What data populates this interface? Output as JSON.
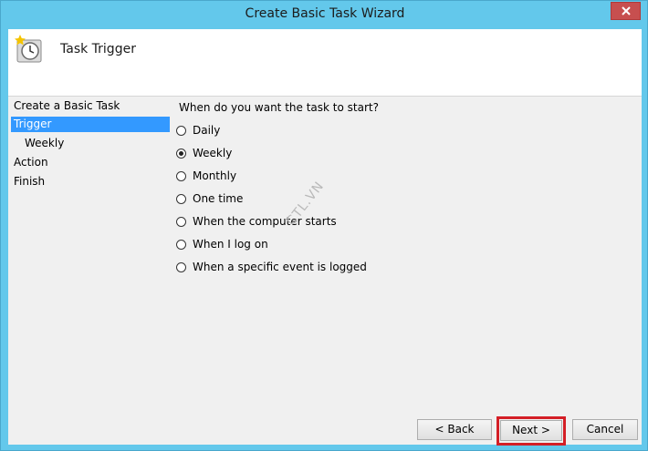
{
  "window": {
    "title": "Create Basic Task Wizard"
  },
  "header": {
    "title": "Task Trigger",
    "icon": "clock-star-icon"
  },
  "nav": {
    "items": [
      {
        "label": "Create a Basic Task"
      },
      {
        "label": "Trigger"
      },
      {
        "label": "Weekly"
      },
      {
        "label": "Action"
      },
      {
        "label": "Finish"
      }
    ]
  },
  "main": {
    "question": "When do you want the task to start?",
    "options": [
      {
        "label": "Daily",
        "checked": false
      },
      {
        "label": "Weekly",
        "checked": true
      },
      {
        "label": "Monthly",
        "checked": false
      },
      {
        "label": "One time",
        "checked": false
      },
      {
        "label": "When the computer starts",
        "checked": false
      },
      {
        "label": "When I log on",
        "checked": false
      },
      {
        "label": "When a specific event is logged",
        "checked": false
      }
    ],
    "watermark": "CTL.VN"
  },
  "buttons": {
    "back": "< Back",
    "next": "Next >",
    "cancel": "Cancel"
  },
  "colors": {
    "frame": "#63c8eb",
    "selected": "#3399ff",
    "highlight": "#d41f26"
  }
}
